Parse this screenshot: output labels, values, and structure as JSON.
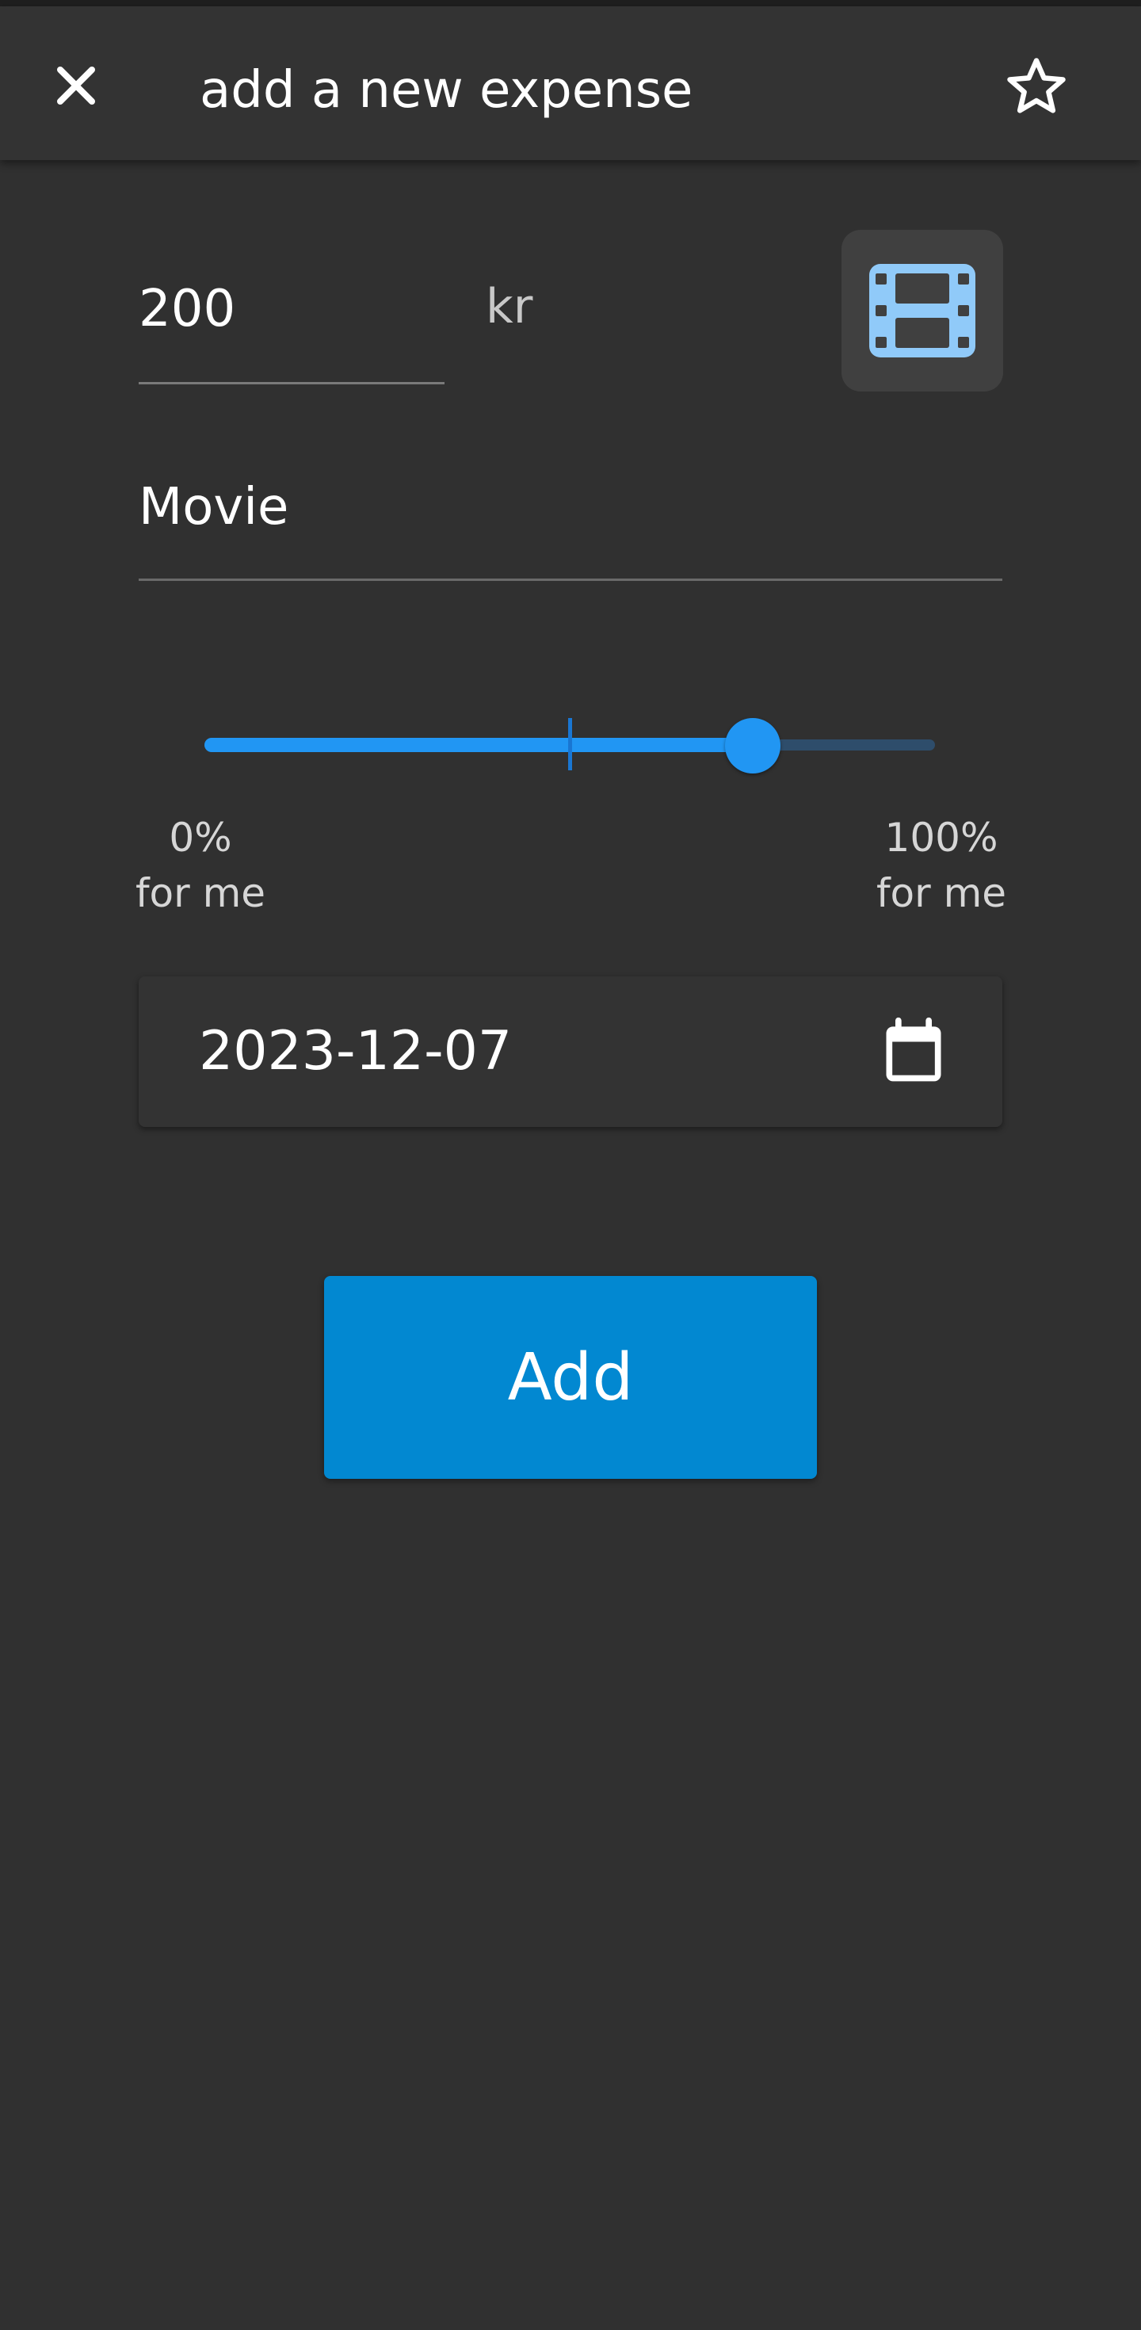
{
  "app_bar": {
    "title": "add a new expense",
    "close_icon": "close-icon",
    "favorite_icon": "star-outline-icon"
  },
  "form": {
    "amount": {
      "value": "200",
      "currency": "kr"
    },
    "category": {
      "icon": "movie-film-icon",
      "icon_color": "#90caf9"
    },
    "description": {
      "value": "Movie"
    },
    "split_slider": {
      "value_percent_for_me": 75,
      "tick_percent": 50,
      "min_label": "0%",
      "min_sublabel": "for me",
      "max_label": "100%",
      "max_sublabel": "for me"
    },
    "date": {
      "value": "2023-12-07",
      "icon": "calendar-icon"
    },
    "submit_label": "Add"
  },
  "colors": {
    "background": "#303030",
    "app_bar": "#333333",
    "accent": "#2196f3",
    "button": "#0288d1"
  }
}
